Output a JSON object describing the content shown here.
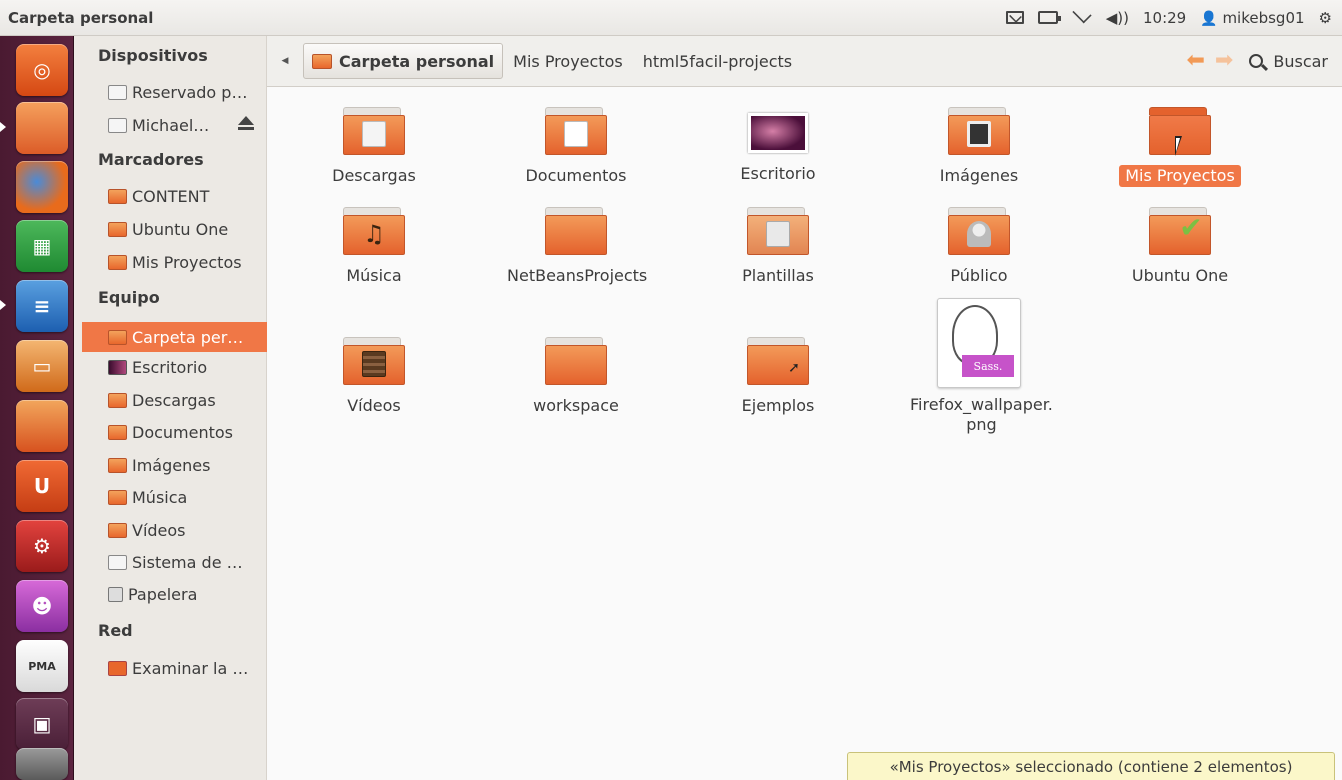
{
  "window": {
    "title": "Carpeta personal"
  },
  "panel": {
    "time": "10:29",
    "user": "mikebsg01"
  },
  "sidebar": {
    "headers": {
      "devices": "Dispositivos",
      "bookmarks": "Marcadores",
      "computer": "Equipo",
      "network": "Red"
    },
    "devices": [
      "Reservado p…",
      "Michael…"
    ],
    "bookmarks": [
      "CONTENT",
      "Ubuntu One",
      "Mis Proyectos"
    ],
    "computer": [
      "Carpeta per…",
      "Escritorio",
      "Descargas",
      "Documentos",
      "Imágenes",
      "Música",
      "Vídeos",
      "Sistema de …",
      "Papelera"
    ],
    "network": [
      "Examinar la …"
    ],
    "active": "Carpeta per…"
  },
  "toolbar": {
    "breadcrumbs": [
      "Carpeta personal",
      "Mis Proyectos",
      "html5facil-projects"
    ],
    "search_label": "Buscar"
  },
  "files": [
    "Descargas",
    "Documentos",
    "Escritorio",
    "Imágenes",
    "Mis Proyectos",
    "Música",
    "NetBeansProjects",
    "Plantillas",
    "Público",
    "Ubuntu One",
    "Vídeos",
    "workspace",
    "Ejemplos",
    "Firefox_wallpaper.\npng"
  ],
  "selected_file": "Mis Proyectos",
  "thumbnail_text": "Sass.",
  "launcher_letters": {
    "ubuntu_one": "U",
    "pma": "PMA"
  },
  "status": {
    "text": "«Mis Proyectos» seleccionado (contiene 2 elementos)"
  },
  "colors": {
    "accent": "#f07746",
    "launcher": "#5b2440",
    "folder": "#e8672c"
  }
}
